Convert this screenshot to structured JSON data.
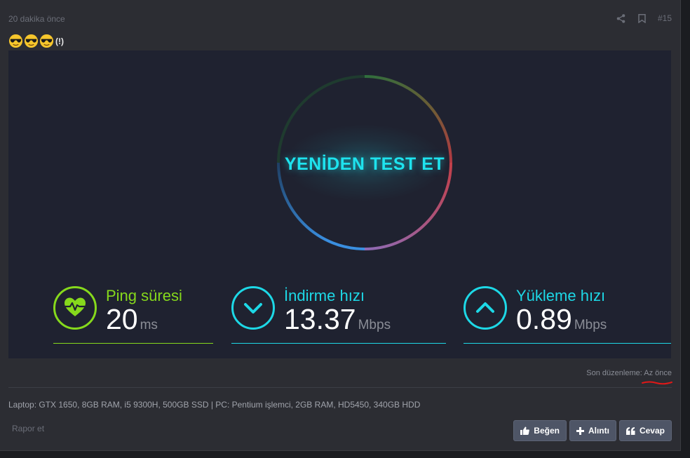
{
  "post": {
    "time": "20 dakika önce",
    "number": "#15",
    "share_icon": "share-icon",
    "bookmark_icon": "bookmark-icon",
    "emojis": [
      "sunglasses-emoji",
      "sunglasses-emoji",
      "sunglasses-emoji"
    ],
    "exclaim": "(!)"
  },
  "speedtest": {
    "retest_label": "YENİDEN TEST ET",
    "ring_colors": [
      "#2b7fd0",
      "#c44848",
      "#3f7f3a"
    ],
    "ping": {
      "label": "Ping süresi",
      "value": "20",
      "unit": "ms",
      "color": "#86d91c",
      "icon": "heartbeat-icon"
    },
    "download": {
      "label": "İndirme hızı",
      "value": "13.37",
      "unit": "Mbps",
      "color": "#1dd8e6",
      "icon": "chevron-down-icon"
    },
    "upload": {
      "label": "Yükleme hızı",
      "value": "0.89",
      "unit": "Mbps",
      "color": "#1dd8e6",
      "icon": "chevron-up-icon"
    }
  },
  "edited": {
    "prefix": "Son düzenleme:",
    "time": "Az önce"
  },
  "signature": "Laptop: GTX 1650, 8GB RAM, i5 9300H, 500GB SSD | PC: Pentium işlemci, 2GB RAM, HD5450, 340GB HDD",
  "actions": {
    "report": "Rapor et",
    "like": "Beğen",
    "quote": "Alıntı",
    "reply": "Cevap"
  }
}
